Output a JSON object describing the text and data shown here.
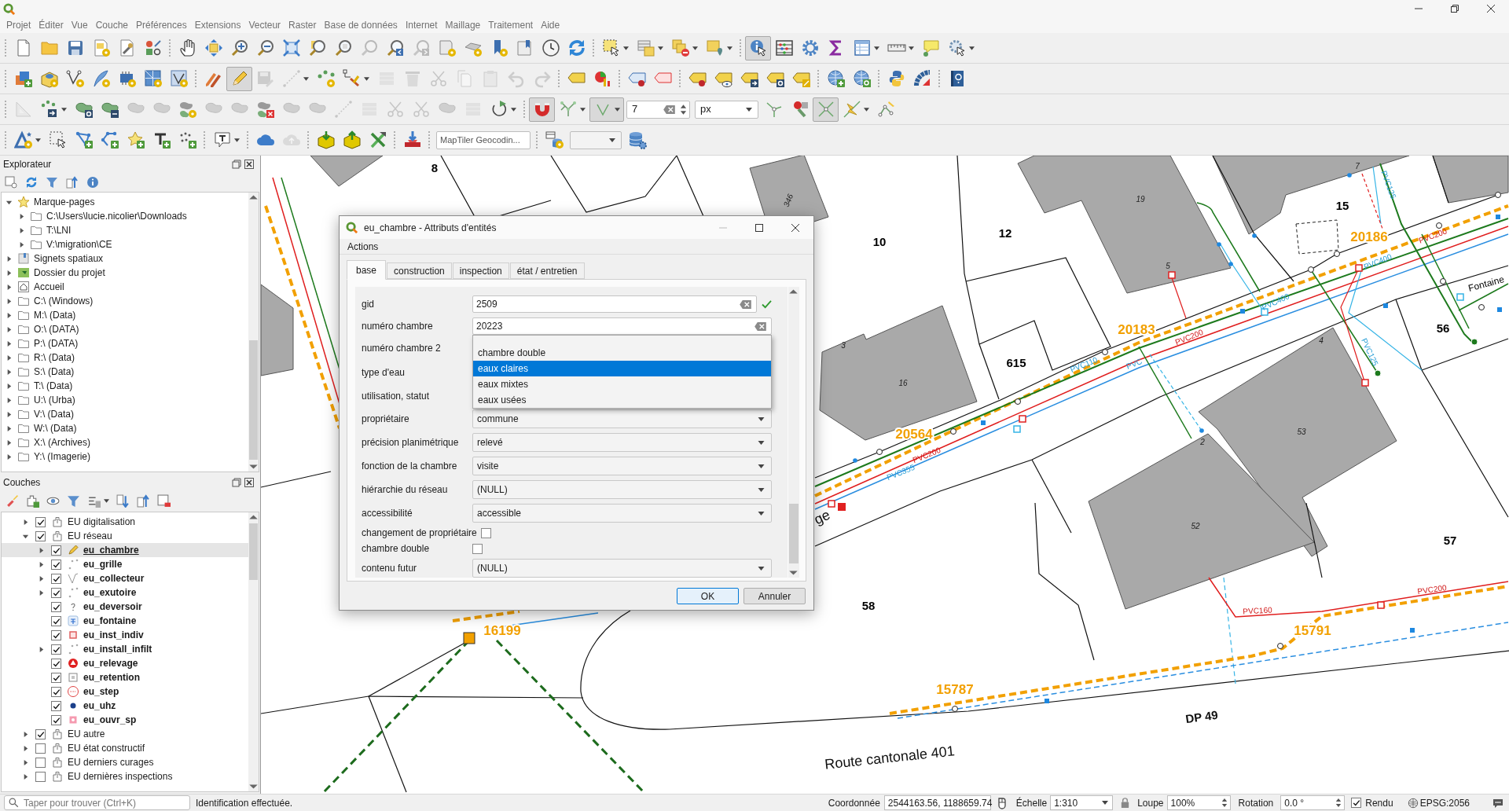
{
  "menu": [
    "Projet",
    "Éditer",
    "Vue",
    "Couche",
    "Préférences",
    "Extensions",
    "Vecteur",
    "Raster",
    "Base de données",
    "Internet",
    "Maillage",
    "Traitement",
    "Aide"
  ],
  "toolbars": [
    {
      "groups": [
        [
          {
            "kind": "tool",
            "pressed": false,
            "disabled": false
          },
          {
            "kind": "tool",
            "pressed": false,
            "disabled": false
          },
          {
            "kind": "tool",
            "pressed": false,
            "disabled": false
          },
          {
            "kind": "tool",
            "pressed": false,
            "disabled": false
          },
          {
            "kind": "tool",
            "pressed": false,
            "disabled": false
          },
          {
            "kind": "tool",
            "pressed": false,
            "disabled": false
          }
        ],
        [
          {
            "kind": "tool",
            "pressed": false,
            "disabled": false
          },
          {
            "kind": "tool",
            "pressed": false,
            "disabled": false
          },
          {
            "kind": "tool",
            "pressed": false,
            "disabled": false
          },
          {
            "kind": "tool",
            "pressed": false,
            "disabled": false
          },
          {
            "kind": "tool",
            "pressed": false,
            "disabled": false
          },
          {
            "kind": "tool",
            "pressed": false,
            "disabled": false
          },
          {
            "kind": "tool",
            "pressed": false,
            "disabled": false
          },
          {
            "kind": "tool",
            "pressed": false,
            "disabled": true
          },
          {
            "kind": "tool",
            "pressed": false,
            "disabled": false
          },
          {
            "kind": "tool",
            "pressed": false,
            "disabled": true
          },
          {
            "kind": "tool",
            "pressed": false,
            "disabled": false
          },
          {
            "kind": "tool",
            "pressed": false,
            "disabled": false
          },
          {
            "kind": "tool",
            "pressed": false,
            "disabled": false
          },
          {
            "kind": "tool",
            "pressed": false,
            "disabled": false
          },
          {
            "kind": "tool",
            "pressed": false,
            "disabled": false
          },
          {
            "kind": "tool",
            "pressed": false,
            "disabled": false
          }
        ],
        [
          {
            "kind": "tool",
            "pressed": false,
            "disabled": false
          },
          {
            "kind": "tool",
            "pressed": false,
            "disabled": false
          },
          {
            "kind": "tool",
            "pressed": false,
            "disabled": false
          },
          {
            "kind": "tool",
            "pressed": false,
            "disabled": false
          }
        ],
        [
          {
            "kind": "tool",
            "pressed": true,
            "disabled": false
          },
          {
            "kind": "tool",
            "pressed": false,
            "disabled": false
          },
          {
            "kind": "tool",
            "pressed": false,
            "disabled": false
          },
          {
            "kind": "tool",
            "pressed": false,
            "disabled": false
          },
          {
            "kind": "tool",
            "pressed": false,
            "disabled": false
          },
          {
            "kind": "tool",
            "pressed": false,
            "disabled": false
          },
          {
            "kind": "tool",
            "pressed": false,
            "disabled": false
          },
          {
            "kind": "tool",
            "pressed": false,
            "disabled": false
          }
        ]
      ]
    },
    {
      "groups": [
        [
          {
            "kind": "tool",
            "pressed": false,
            "disabled": false
          },
          {
            "kind": "tool",
            "pressed": false,
            "disabled": false
          },
          {
            "kind": "tool",
            "pressed": false,
            "disabled": false
          },
          {
            "kind": "tool",
            "pressed": false,
            "disabled": false
          },
          {
            "kind": "tool",
            "pressed": false,
            "disabled": false
          },
          {
            "kind": "tool",
            "pressed": false,
            "disabled": false
          },
          {
            "kind": "tool",
            "pressed": false,
            "disabled": false
          }
        ],
        [
          {
            "kind": "tool",
            "pressed": false,
            "disabled": false
          },
          {
            "kind": "tool",
            "pressed": true,
            "disabled": false
          },
          {
            "kind": "tool",
            "pressed": false,
            "disabled": true
          },
          {
            "kind": "tool",
            "pressed": false,
            "disabled": true
          },
          {
            "kind": "tool",
            "pressed": false,
            "disabled": false
          },
          {
            "kind": "tool",
            "pressed": false,
            "disabled": false
          },
          {
            "kind": "tool",
            "pressed": false,
            "disabled": true
          },
          {
            "kind": "tool",
            "pressed": false,
            "disabled": true
          },
          {
            "kind": "tool",
            "pressed": false,
            "disabled": true
          },
          {
            "kind": "tool",
            "pressed": false,
            "disabled": true
          },
          {
            "kind": "tool",
            "pressed": false,
            "disabled": true
          },
          {
            "kind": "tool",
            "pressed": false,
            "disabled": true
          },
          {
            "kind": "tool",
            "pressed": false,
            "disabled": true
          }
        ],
        [
          {
            "kind": "tool",
            "pressed": false,
            "disabled": false
          },
          {
            "kind": "tool",
            "pressed": false,
            "disabled": false
          }
        ],
        [
          {
            "kind": "tool",
            "pressed": false,
            "disabled": false
          },
          {
            "kind": "tool",
            "pressed": false,
            "disabled": false
          }
        ],
        [
          {
            "kind": "tool",
            "pressed": false,
            "disabled": false
          },
          {
            "kind": "tool",
            "pressed": false,
            "disabled": false
          },
          {
            "kind": "tool",
            "pressed": false,
            "disabled": false
          },
          {
            "kind": "tool",
            "pressed": false,
            "disabled": false
          },
          {
            "kind": "tool",
            "pressed": false,
            "disabled": false
          }
        ],
        [
          {
            "kind": "tool",
            "pressed": false,
            "disabled": false
          },
          {
            "kind": "tool",
            "pressed": false,
            "disabled": false
          }
        ],
        [
          {
            "kind": "tool",
            "pressed": false,
            "disabled": false
          },
          {
            "kind": "tool",
            "pressed": false,
            "disabled": false
          }
        ],
        [
          {
            "kind": "tool",
            "pressed": false,
            "disabled": false
          }
        ]
      ]
    },
    {
      "groups": [
        [
          {
            "kind": "tool",
            "pressed": false,
            "disabled": true
          },
          {
            "kind": "tool",
            "pressed": false,
            "disabled": false
          },
          {
            "kind": "tool",
            "pressed": false,
            "disabled": false
          },
          {
            "kind": "tool",
            "pressed": false,
            "disabled": false
          },
          {
            "kind": "tool",
            "pressed": false,
            "disabled": true
          },
          {
            "kind": "tool",
            "pressed": false,
            "disabled": true
          },
          {
            "kind": "tool",
            "pressed": false,
            "disabled": false
          },
          {
            "kind": "tool",
            "pressed": false,
            "disabled": true
          },
          {
            "kind": "tool",
            "pressed": false,
            "disabled": true
          },
          {
            "kind": "tool",
            "pressed": false,
            "disabled": false
          },
          {
            "kind": "tool",
            "pressed": false,
            "disabled": true
          },
          {
            "kind": "tool",
            "pressed": false,
            "disabled": true
          },
          {
            "kind": "tool",
            "pressed": false,
            "disabled": true
          },
          {
            "kind": "tool",
            "pressed": false,
            "disabled": true
          },
          {
            "kind": "tool",
            "pressed": false,
            "disabled": true
          },
          {
            "kind": "tool",
            "pressed": false,
            "disabled": true
          },
          {
            "kind": "tool",
            "pressed": false,
            "disabled": true
          },
          {
            "kind": "tool",
            "pressed": false,
            "disabled": true
          },
          {
            "kind": "tool",
            "pressed": false,
            "disabled": false
          }
        ],
        [
          {
            "kind": "tool",
            "pressed": true,
            "disabled": false
          },
          {
            "kind": "tool",
            "pressed": false,
            "disabled": false
          },
          {
            "kind": "tool",
            "pressed": true,
            "disabled": false
          },
          {
            "kind": "spin",
            "value": "7"
          },
          {
            "kind": "combo",
            "value": "px"
          },
          {
            "kind": "tool",
            "pressed": false,
            "disabled": false
          },
          {
            "kind": "tool",
            "pressed": false,
            "disabled": false
          },
          {
            "kind": "tool",
            "pressed": true,
            "disabled": false
          },
          {
            "kind": "tool",
            "pressed": false,
            "disabled": false
          },
          {
            "kind": "tool",
            "pressed": false,
            "disabled": false
          }
        ]
      ]
    },
    {
      "groups": [
        [
          {
            "kind": "tool",
            "pressed": false,
            "disabled": false
          },
          {
            "kind": "tool",
            "pressed": false,
            "disabled": false
          },
          {
            "kind": "tool",
            "pressed": false,
            "disabled": false
          },
          {
            "kind": "tool",
            "pressed": false,
            "disabled": false
          },
          {
            "kind": "tool",
            "pressed": false,
            "disabled": false
          },
          {
            "kind": "tool",
            "pressed": false,
            "disabled": false
          },
          {
            "kind": "tool",
            "pressed": false,
            "disabled": false
          }
        ],
        [
          {
            "kind": "tool",
            "pressed": false,
            "disabled": false
          }
        ],
        [
          {
            "kind": "tool",
            "pressed": false,
            "disabled": false
          },
          {
            "kind": "tool",
            "pressed": false,
            "disabled": true
          }
        ],
        [
          {
            "kind": "tool",
            "pressed": false,
            "disabled": false
          },
          {
            "kind": "tool",
            "pressed": false,
            "disabled": false
          },
          {
            "kind": "tool",
            "pressed": false,
            "disabled": false
          }
        ],
        [
          {
            "kind": "tool",
            "pressed": false,
            "disabled": false
          }
        ],
        [
          {
            "kind": "search",
            "placeholder": "MapTiler Geocodin..."
          }
        ],
        [
          {
            "kind": "tool",
            "pressed": false,
            "disabled": false
          },
          {
            "kind": "combo"
          },
          {
            "kind": "tool",
            "pressed": false,
            "disabled": false
          }
        ]
      ]
    }
  ],
  "explorer": {
    "title": "Explorateur",
    "tree": [
      {
        "label": "Marque-pages",
        "expanded": true,
        "children": [
          {
            "label": "C:\\Users\\lucie.nicolier\\Downloads",
            "expanded": false
          },
          {
            "label": "T:\\LNI",
            "expanded": false
          },
          {
            "label": "V:\\migration\\CE",
            "expanded": false
          }
        ]
      },
      {
        "label": "Signets spatiaux",
        "expanded": false
      },
      {
        "label": "Dossier du projet",
        "expanded": false
      },
      {
        "label": "Accueil",
        "expanded": false
      },
      {
        "label": "C:\\ (Windows)",
        "expanded": false
      },
      {
        "label": "M:\\ (Data)",
        "expanded": false
      },
      {
        "label": "O:\\ (DATA)",
        "expanded": false
      },
      {
        "label": "P:\\ (DATA)",
        "expanded": false
      },
      {
        "label": "R:\\ (Data)",
        "expanded": false
      },
      {
        "label": "S:\\ (Data)",
        "expanded": false
      },
      {
        "label": "T:\\ (Data)",
        "expanded": false
      },
      {
        "label": "U:\\ (Urba)",
        "expanded": false
      },
      {
        "label": "V:\\ (Data)",
        "expanded": false
      },
      {
        "label": "W:\\ (Data)",
        "expanded": false
      },
      {
        "label": "X:\\ (Archives)",
        "expanded": false
      },
      {
        "label": "Y:\\ (Imagerie)",
        "expanded": false
      }
    ]
  },
  "layers_panel": {
    "title": "Couches",
    "tree": [
      {
        "label": "EU digitalisation",
        "kind": "group",
        "checked": true,
        "expanded": false,
        "selected": false
      },
      {
        "label": "EU réseau",
        "kind": "group",
        "checked": true,
        "expanded": true,
        "selected": false,
        "children": [
          {
            "label": "eu_chambre",
            "kind": "layer",
            "checked": true,
            "expanded": false,
            "selected": true,
            "editing": true
          },
          {
            "label": "eu_grille",
            "kind": "layer",
            "checked": true,
            "expanded": false,
            "selected": false,
            "editing": false
          },
          {
            "label": "eu_collecteur",
            "kind": "layer",
            "checked": true,
            "expanded": false,
            "selected": false,
            "editing": false
          },
          {
            "label": "eu_exutoire",
            "kind": "layer",
            "checked": true,
            "expanded": false,
            "selected": false,
            "editing": false
          },
          {
            "label": "eu_deversoir",
            "kind": "layer",
            "checked": true,
            "selected": false,
            "editing": false
          },
          {
            "label": "eu_fontaine",
            "kind": "layer",
            "checked": true,
            "selected": false,
            "editing": false
          },
          {
            "label": "eu_inst_indiv",
            "kind": "layer",
            "checked": true,
            "selected": false,
            "editing": false
          },
          {
            "label": "eu_install_infilt",
            "kind": "layer",
            "checked": true,
            "expanded": false,
            "selected": false,
            "editing": false
          },
          {
            "label": "eu_relevage",
            "kind": "layer",
            "checked": true,
            "selected": false,
            "editing": false
          },
          {
            "label": "eu_retention",
            "kind": "layer",
            "checked": true,
            "selected": false,
            "editing": false
          },
          {
            "label": "eu_step",
            "kind": "layer",
            "checked": true,
            "selected": false,
            "editing": false
          },
          {
            "label": "eu_uhz",
            "kind": "layer",
            "checked": true,
            "selected": false,
            "editing": false
          },
          {
            "label": "eu_ouvr_sp",
            "kind": "layer",
            "checked": true,
            "selected": false,
            "editing": false
          }
        ]
      },
      {
        "label": "EU autre",
        "kind": "group",
        "checked": true,
        "expanded": false,
        "selected": false
      },
      {
        "label": "EU état constructif",
        "kind": "group",
        "checked": false,
        "expanded": false,
        "selected": false
      },
      {
        "label": "EU derniers curages",
        "kind": "group",
        "checked": false,
        "expanded": false,
        "selected": false
      },
      {
        "label": "EU dernières inspections",
        "kind": "group",
        "checked": false,
        "expanded": false,
        "selected": false
      }
    ]
  },
  "map": {
    "labels": [
      {
        "kind": "parcel",
        "text": "8"
      },
      {
        "kind": "building",
        "text": "346"
      },
      {
        "kind": "building",
        "text": "19"
      },
      {
        "kind": "building",
        "text": "7"
      },
      {
        "kind": "pipe_cyan",
        "text": "PVC125"
      },
      {
        "kind": "parcel",
        "text": "15"
      },
      {
        "kind": "manhole",
        "text": "20186"
      },
      {
        "kind": "pipe",
        "text": "PVC200"
      },
      {
        "kind": "parcel",
        "text": "10"
      },
      {
        "kind": "parcel",
        "text": "12"
      },
      {
        "kind": "pipe_cyan",
        "text": "PVC400"
      },
      {
        "kind": "building",
        "text": "5"
      },
      {
        "kind": "place",
        "text": "Fontaine"
      },
      {
        "kind": "pipe_cyan",
        "text": "PVC400"
      },
      {
        "kind": "parcel",
        "text": "56"
      },
      {
        "kind": "building",
        "text": "3"
      },
      {
        "kind": "manhole",
        "text": "20183"
      },
      {
        "kind": "pipe",
        "text": "PVC200"
      },
      {
        "kind": "building",
        "text": "4"
      },
      {
        "kind": "pipe_cyan",
        "text": "PVC125"
      },
      {
        "kind": "parcel",
        "text": "615"
      },
      {
        "kind": "pipe_cyan",
        "text": "PVC110"
      },
      {
        "kind": "pipe_cyan",
        "text": "PVC"
      },
      {
        "kind": "building",
        "text": "16"
      },
      {
        "kind": "building",
        "text": "53"
      },
      {
        "kind": "manhole",
        "text": "20564"
      },
      {
        "kind": "building",
        "text": "2"
      },
      {
        "kind": "pipe",
        "text": "PVC200"
      },
      {
        "kind": "pipe_cyan",
        "text": "PVC355"
      },
      {
        "kind": "street",
        "text": "ge"
      },
      {
        "kind": "building",
        "text": "52"
      },
      {
        "kind": "parcel",
        "text": "57"
      },
      {
        "kind": "pipe",
        "text": "PVC200"
      },
      {
        "kind": "parcel",
        "text": "58"
      },
      {
        "kind": "pipe",
        "text": "PVC160"
      },
      {
        "kind": "manhole",
        "text": "16199"
      },
      {
        "kind": "manhole",
        "text": "15791"
      },
      {
        "kind": "manhole",
        "text": "15787"
      },
      {
        "kind": "road_code",
        "text": "DP 49"
      },
      {
        "kind": "street",
        "text": "Route cantonale 401"
      }
    ]
  },
  "dialog": {
    "title": "eu_chambre - Attributs d'entités",
    "menu": [
      "Actions"
    ],
    "tabs": [
      {
        "label": "base",
        "selected": true
      },
      {
        "label": "construction",
        "selected": false
      },
      {
        "label": "inspection",
        "selected": false
      },
      {
        "label": "état / entretien",
        "selected": false
      }
    ],
    "fields": [
      {
        "label": "gid",
        "kind": "text",
        "value": "2509",
        "constraint_ok": true
      },
      {
        "label": "numéro chambre",
        "kind": "text",
        "value": "20223",
        "constraint_ok": false
      },
      {
        "label": "numéro chambre 2",
        "kind": "covered"
      },
      {
        "label": "type d'eau",
        "kind": "combo",
        "open": true,
        "options": [
          {
            "label": "chambre double",
            "selected": false
          },
          {
            "label": "eaux claires",
            "selected": true
          },
          {
            "label": "eaux mixtes",
            "selected": false
          },
          {
            "label": "eaux usées",
            "selected": false
          }
        ]
      },
      {
        "label": "utilisation, statut",
        "kind": "covered"
      },
      {
        "label": "propriétaire",
        "kind": "combo",
        "open": false,
        "value": "commune"
      },
      {
        "label": "précision planimétrique",
        "kind": "combo",
        "open": false,
        "value": "relevé"
      },
      {
        "label": "fonction de la chambre",
        "kind": "combo",
        "open": false,
        "value": "visite"
      },
      {
        "label": "hiérarchie du réseau",
        "kind": "combo",
        "open": false,
        "value": "(NULL)"
      },
      {
        "label": "accessibilité",
        "kind": "combo",
        "open": false,
        "value": "accessible"
      },
      {
        "label": "changement de propriétaire",
        "kind": "checkbox",
        "checked": false
      },
      {
        "label": "chambre double",
        "kind": "checkbox",
        "checked": false
      },
      {
        "label": "contenu futur",
        "kind": "combo",
        "open": false,
        "value": "(NULL)"
      }
    ],
    "buttons": [
      {
        "label": "OK",
        "default": true
      },
      {
        "label": "Annuler",
        "default": false
      }
    ]
  },
  "status_bar": {
    "search": {
      "placeholder": "Taper pour trouver (Ctrl+K)"
    },
    "message": "Identification effectuée.",
    "coordinate": {
      "label": "Coordonnée",
      "value": "2544163.56, 1188659.74"
    },
    "scale": {
      "label": "Échelle",
      "value": "1:310"
    },
    "magnifier": {
      "label": "Loupe",
      "value": "100%"
    },
    "rotation": {
      "label": "Rotation",
      "value": "0.0 °"
    },
    "render": {
      "label": "Rendu",
      "checked": true
    },
    "crs": "EPSG:2056"
  }
}
